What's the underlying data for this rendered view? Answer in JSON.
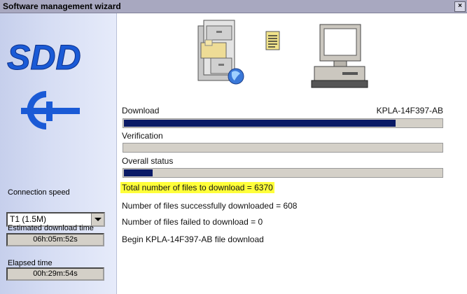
{
  "window": {
    "title": "Software management wizard",
    "close_glyph": "×"
  },
  "sidebar": {
    "logo_text": "SDD",
    "connection_speed_label": "Connection speed",
    "connection_speed_value": "T1 (1.5M)",
    "estimated_label": "Estimated download time",
    "estimated_value": "06h:05m:52s",
    "elapsed_label": "Elapsed time",
    "elapsed_value": "00h:29m:54s"
  },
  "progress": {
    "download_label": "Download",
    "download_file": "KPLA-14F397-AB",
    "download_fraction": 0.85,
    "verification_label": "Verification",
    "verification_fraction": 0,
    "overall_label": "Overall status",
    "overall_fraction": 0.09
  },
  "status": {
    "total_files": "Total number of files to download = 6370",
    "success_files": "Number of files successfully downloaded = 608",
    "failed_files": "Number of files failed to download = 0",
    "current_action": "Begin KPLA-14F397-AB file download"
  },
  "colors": {
    "progress_fill": "#0a1a66",
    "logo_blue": "#1a5ad6",
    "highlight": "#ffff3a"
  },
  "icons": {
    "server": "file-server-icon",
    "document": "document-icon",
    "computer": "computer-icon"
  }
}
